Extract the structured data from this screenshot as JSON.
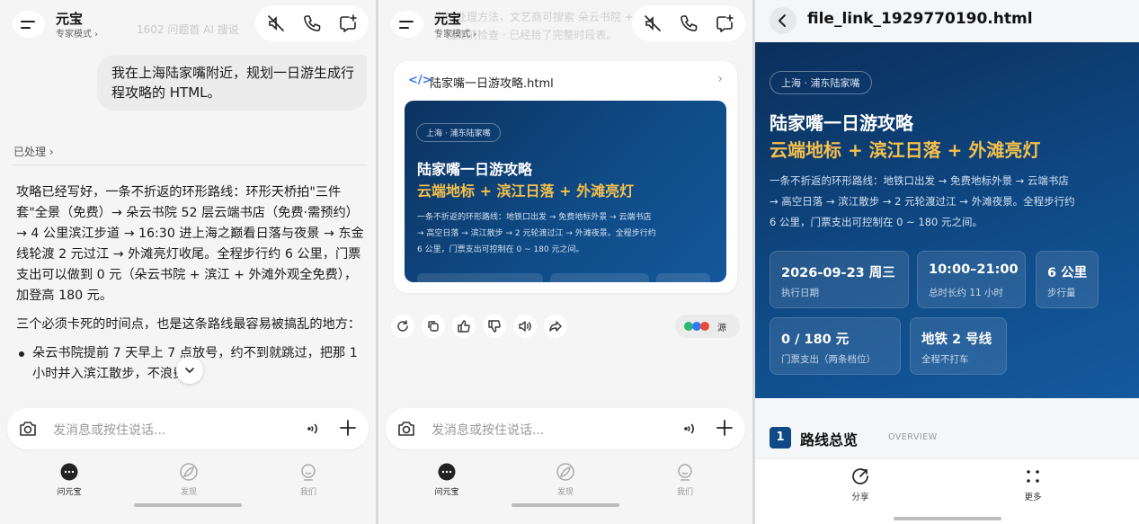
{
  "header": {
    "app_name": "元宝",
    "mode": "专家模式 ›",
    "ghost_top_p1": "1602 问题首 AI 搜说",
    "ghost_top_p2a": "由的处理方法，文艺商可搜索 朵云书院 +",
    "ghost_top_p2b": "，我提前检查 · 已经拾了完整时段表。"
  },
  "chat": {
    "user_message": "我在上海陆家嘴附近，规划一日游生成行程攻略的 HTML。",
    "processed_label": "已处理 ›",
    "answer_p1": "攻略已经写好，一条不折返的环形路线：环形天桥拍\"三件套\"全景（免费）→ 朵云书院 52 层云端书店（免费·需预约）→ 4 公里滨江步道 → 16:30 进上海之巅看日落与夜景 → 东金线轮渡 2 元过江 → 外滩亮灯收尾。全程步行约 6 公里，门票支出可以做到 0 元（朵云书院 + 滨江 + 外滩外观全免费），加登高 180 元。",
    "answer_p2": "三个必须卡死的时间点，也是这条路线最容易被搞乱的地方：",
    "answer_bullet1": "朵云书院提前 7 天早上 7 点放号，约不到就跳过，把那 1 小时并入滨江散步，不浪费。"
  },
  "input": {
    "placeholder": "发消息或按住说话..."
  },
  "nav": {
    "items": [
      {
        "label": "问元宝"
      },
      {
        "label": "发现"
      },
      {
        "label": "我们"
      }
    ]
  },
  "file_card": {
    "file_name": "陆家嘴一日游攻略.html",
    "source_label": "源"
  },
  "page": {
    "tag": "上海 · 浦东陆家嘴",
    "title_line1": "陆家嘴一日游攻略",
    "title_line2": "云端地标 + 滨江日落 + 外滩亮灯",
    "desc_line1": "一条不折返的环形路线：地铁口出发 → 免费地标外景 → 云端书店",
    "desc_line2": "→ 高空日落 → 滨江散步 → 2 元轮渡过江 → 外滩夜景。全程步行约",
    "desc_line3": "6 公里，门票支出可控制在 0 ~ 180 元之间。",
    "stats": [
      {
        "value": "2026-09-23 周三",
        "label": "执行日期"
      },
      {
        "value": "10:00–21:00",
        "label": "总时长约 11 小时"
      },
      {
        "value": "6 公里",
        "label": "步行量"
      },
      {
        "value": "0 / 180 元",
        "label": "门票支出（两条档位）"
      },
      {
        "value": "地铁 2 号线",
        "label": "全程不打车"
      }
    ],
    "section_num": "1",
    "section_title": "路线总览",
    "section_sub": "OVERVIEW"
  },
  "viewer": {
    "title": "file_link_1929770190.html",
    "share_label": "分享",
    "more_label": "更多"
  },
  "colors": {
    "accent_blue": "#0f4a86",
    "highlight_yellow": "#f6c04a",
    "code_blue": "#3478f6"
  }
}
